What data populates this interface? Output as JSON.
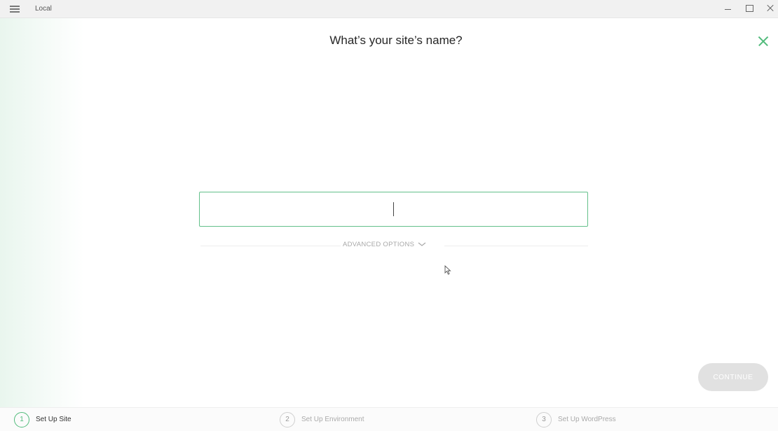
{
  "window": {
    "title": "Local",
    "menu_icon": "hamburger-menu-icon",
    "controls": [
      "minimize-icon",
      "maximize-icon",
      "close-icon"
    ]
  },
  "main": {
    "heading": "What’s your site’s name?",
    "close_icon": "close-x-icon",
    "site_name_input": {
      "value": "",
      "placeholder": ""
    },
    "advanced_options_label": "ADVANCED OPTIONS",
    "continue_label": "CONTINUE"
  },
  "steps": [
    {
      "number": "1",
      "label": "Set Up Site",
      "active": true
    },
    {
      "number": "2",
      "label": "Set Up Environment",
      "active": false
    },
    {
      "number": "3",
      "label": "Set Up WordPress",
      "active": false
    }
  ],
  "colors": {
    "accent": "#51bb7b",
    "input_border": "#63c08a",
    "continue_disabled": "#e1e1e1",
    "titlebar": "#f1f1f1"
  }
}
